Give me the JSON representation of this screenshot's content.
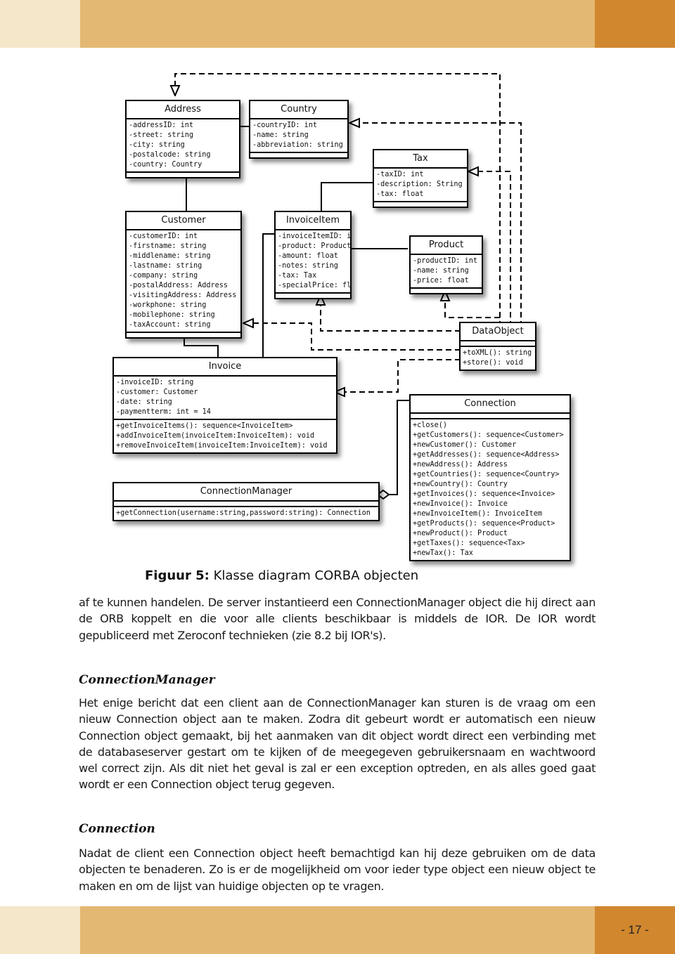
{
  "page": {
    "number": "- 17 -",
    "colors": {
      "band_light": "#f4e7ca",
      "band_mid": "#e3b872",
      "band_dark": "#d0872e"
    }
  },
  "diagram": {
    "classes": {
      "address": {
        "name": "Address",
        "attributes": [
          "-addressID: int",
          "-street: string",
          "-city: string",
          "-postalcode: string",
          "-country: Country"
        ],
        "operations": []
      },
      "country": {
        "name": "Country",
        "attributes": [
          "-countryID: int",
          "-name: string",
          "-abbreviation: string"
        ],
        "operations": []
      },
      "tax": {
        "name": "Tax",
        "attributes": [
          "-taxID: int",
          "-description: String",
          "-tax: float"
        ],
        "operations": []
      },
      "customer": {
        "name": "Customer",
        "attributes": [
          "-customerID: int",
          "-firstname: string",
          "-middlename: string",
          "-lastname: string",
          "-company: string",
          "-postalAddress: Address",
          "-visitingAddress: Address",
          "-workphone: string",
          "-mobilephone: string",
          "-taxAccount: string"
        ],
        "operations": []
      },
      "invoiceitem": {
        "name": "InvoiceItem",
        "attributes": [
          "-invoiceItemID: int",
          "-product: Product",
          "-amount: float",
          "-notes: string",
          "-tax: Tax",
          "-specialPrice: float"
        ],
        "operations": []
      },
      "product": {
        "name": "Product",
        "attributes": [
          "-productID: int",
          "-name: string",
          "-price: float"
        ],
        "operations": []
      },
      "dataobject": {
        "name": "DataObject",
        "attributes": [],
        "operations": [
          "+toXML(): string",
          "+store(): void"
        ]
      },
      "invoice": {
        "name": "Invoice",
        "attributes": [
          "-invoiceID: string",
          "-customer: Customer",
          "-date: string",
          "-paymentterm: int = 14"
        ],
        "operations": [
          "+getInvoiceItems(): sequence<InvoiceItem>",
          "+addInvoiceItem(invoiceItem:InvoiceItem): void",
          "+removeInvoiceItem(invoiceItem:InvoiceItem): void"
        ]
      },
      "connection": {
        "name": "Connection",
        "attributes": [],
        "operations": [
          "+close()",
          "+getCustomers(): sequence<Customer>",
          "+newCustomer(): Customer",
          "+getAddresses(): sequence<Address>",
          "+newAddress(): Address",
          "+getCountries(): sequence<Country>",
          "+newCountry(): Country",
          "+getInvoices(): sequence<Invoice>",
          "+newInvoice(): Invoice",
          "+newInvoiceItem(): InvoiceItem",
          "+getProducts(): sequence<Product>",
          "+newProduct(): Product",
          "+getTaxes(): sequence<Tax>",
          "+newTax(): Tax"
        ]
      },
      "connectionmanager": {
        "name": "ConnectionManager",
        "attributes": [],
        "operations": [
          "+getConnection(username:string,password:string): Connection"
        ]
      }
    }
  },
  "caption": {
    "label": "Figuur 5:",
    "text": " Klasse diagram CORBA objecten"
  },
  "body": {
    "intro": "af te kunnen handelen. De server instantieerd een ConnectionManager object die hij direct aan de ORB koppelt en die voor alle clients beschikbaar is middels de IOR. De IOR wordt gepubliceerd met Zeroconf technieken (zie 8.2 bij IOR's).",
    "sections": [
      {
        "heading": "ConnectionManager",
        "text": "Het enige bericht dat een client aan de ConnectionManager kan sturen is de vraag om een nieuw Connection object aan te maken. Zodra dit gebeurt wordt er automatisch een nieuw Connection object gemaakt, bij het aanmaken van dit object wordt direct een verbinding met de databaseserver gestart om te kijken of de meegegeven gebruikersnaam en wachtwoord wel correct zijn. Als dit niet het geval is zal er een exception optreden, en als alles goed gaat wordt er een Connection object terug gegeven."
      },
      {
        "heading": "Connection",
        "text": "Nadat de client een Connection object heeft bemachtigd kan hij deze gebruiken om de data objecten te benaderen. Zo is er de mogelijkheid om voor ieder type object een nieuw object te maken en om de lijst van huidige objecten op te vragen."
      }
    ]
  }
}
